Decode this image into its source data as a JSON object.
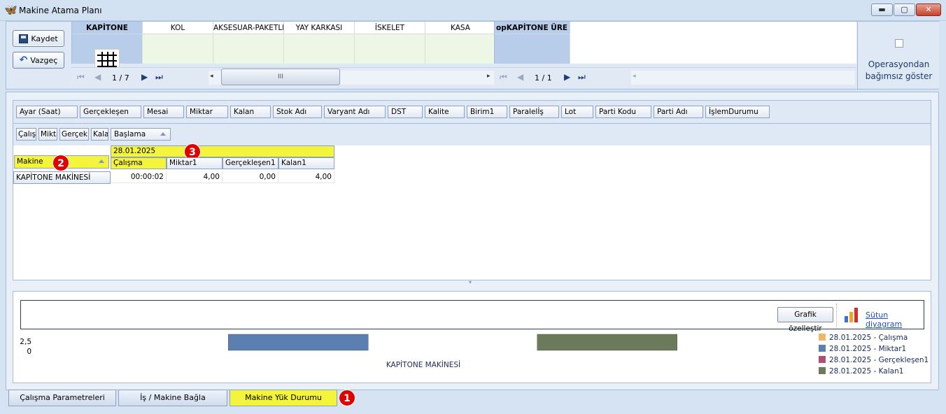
{
  "window": {
    "title": "Makine Atama Planı",
    "icon": "butterfly-icon",
    "min_glyph": "▬",
    "max_glyph": "▢",
    "close_glyph": "✕"
  },
  "toolbar": {
    "save_label": "Kaydet",
    "cancel_label": "Vazgeç"
  },
  "card_grid_1": {
    "columns": [
      "KAPİTONE",
      "KOL",
      "AKSESUAR-PAKETLE",
      "YAY KARKASI",
      "İSKELET",
      "KASA"
    ],
    "nav_position": "1 / 7",
    "scroll_grip": "III"
  },
  "card_grid_2": {
    "columns": [
      "opKAPİTONE ÜRE"
    ],
    "nav_position": "1 / 1"
  },
  "nav": {
    "first": "⏮",
    "prev": "◀",
    "next": "▶",
    "last": "⏭",
    "left_arrow": "◂",
    "right_arrow": "▸"
  },
  "operation_panel": {
    "label": "Operasyondan bağımsız göster"
  },
  "pivot": {
    "filter_fields": [
      "Ayar (Saat)",
      "Gerçekleşen",
      "Mesai",
      "Miktar",
      "Kalan",
      "Stok Adı",
      "Varyant Adı",
      "DST",
      "Kalite",
      "Birim1",
      "Paralelİş",
      "Lot",
      "Parti Kodu",
      "Parti Adı",
      "İşlemDurumu"
    ],
    "data_fields": [
      "Çalışı",
      "Mikta",
      "Gerçekl",
      "Kala"
    ],
    "column_field": "Başlama",
    "row_field": "Makine",
    "column_value": "28.01.2025",
    "value_headers": [
      "Çalışma",
      "Miktar1",
      "Gerçekleşen1",
      "Kalan1"
    ],
    "rows": [
      {
        "label": "KAPİTONE MAKİNESİ",
        "values": [
          "00:00:02",
          "4,00",
          "0,00",
          "4,00"
        ]
      }
    ]
  },
  "badges": {
    "tab": "1",
    "row_field": "2",
    "column_value": "3"
  },
  "chart": {
    "customize_label": "Grafik özelleştir",
    "chart_type_label": "Sütun diyagram",
    "legend_colors": [
      "#f0b860",
      "#5a7fb0",
      "#b05070",
      "#6a7a5a"
    ]
  },
  "chart_data": {
    "type": "bar",
    "categories": [
      "KAPİTONE MAKİNESİ"
    ],
    "series": [
      {
        "name": "28.01.2025 - Çalışma",
        "values": [
          0
        ],
        "color": "#f0b860"
      },
      {
        "name": "28.01.2025 - Miktar1",
        "values": [
          4
        ],
        "color": "#5a7fb0"
      },
      {
        "name": "28.01.2025 - Gerçekleşen1",
        "values": [
          0
        ],
        "color": "#b05070"
      },
      {
        "name": "28.01.2025 - Kalan1",
        "values": [
          4
        ],
        "color": "#6a7a5a"
      }
    ],
    "y_ticks": [
      "2,5",
      "0"
    ],
    "legend_position": "right"
  },
  "tabs": [
    "Çalışma Parametreleri",
    "İş / Makine Bağla",
    "Makine Yük Durumu"
  ],
  "active_tab": "Makine Yük Durumu"
}
